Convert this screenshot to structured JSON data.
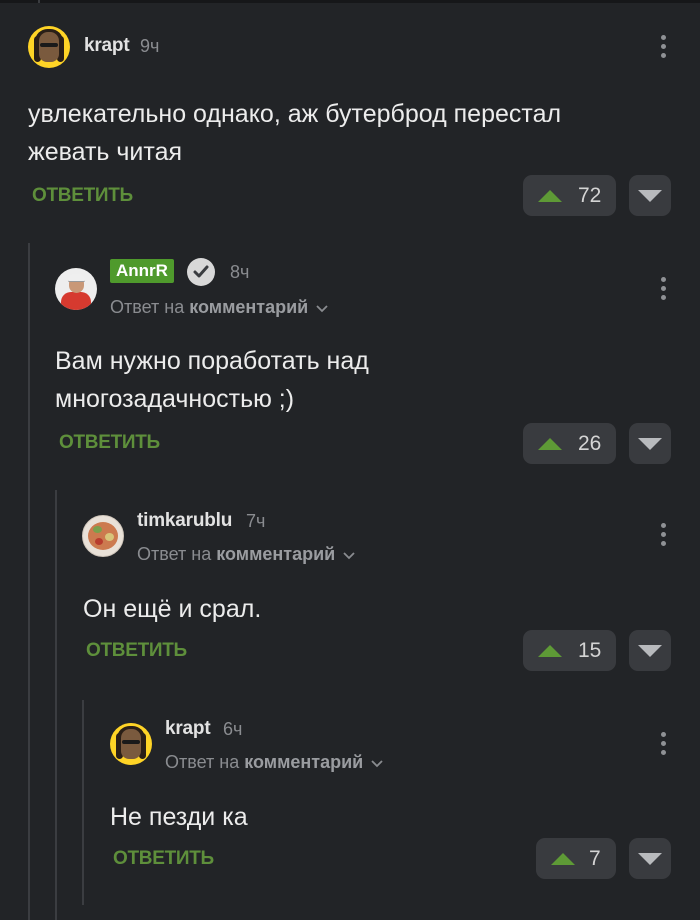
{
  "comments": [
    {
      "user": "krapt",
      "time": "9ч",
      "text": "увлекательно однако, аж бутерброд перестал жевать читая",
      "reply_label": "ОТВЕТИТЬ",
      "votes": "72"
    },
    {
      "user": "AnnrR",
      "time": "8ч",
      "reply_to_prefix": "Ответ на",
      "reply_to_target": "комментарий",
      "text": "Вам нужно поработать над многозадачностью ;)",
      "reply_label": "ОТВЕТИТЬ",
      "votes": "26"
    },
    {
      "user": "timkarublu",
      "time": "7ч",
      "reply_to_prefix": "Ответ на",
      "reply_to_target": "комментарий",
      "text": "Он ещё и срал.",
      "reply_label": "ОТВЕТИТЬ",
      "votes": "15"
    },
    {
      "user": "krapt",
      "time": "6ч",
      "reply_to_prefix": "Ответ на",
      "reply_to_target": "комментарий",
      "text": "Не пезди ка",
      "reply_label": "ОТВЕТИТЬ",
      "votes": "7"
    }
  ],
  "colors": {
    "background": "#222427",
    "accent_green": "#5e8f3b",
    "badge_green": "#4f9a2c",
    "muted_text": "#8a8c90"
  },
  "icons": [
    "user-avatar",
    "verified-check-icon",
    "more-vertical-icon",
    "chevron-down-icon",
    "upvote-icon",
    "downvote-icon"
  ]
}
